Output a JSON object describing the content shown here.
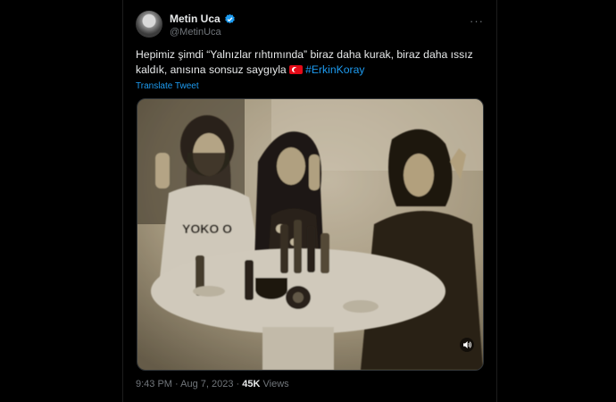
{
  "tweet": {
    "author_name": "Metin Uca",
    "author_handle": "@MetinUca",
    "more_label": "···",
    "text_part1": "Hepimiz  şimdi “Yalnızlar rıhtımında” biraz daha kurak, biraz daha ıssız kaldık, anısına sonsuz saygıyla ",
    "hashtag": "#ErkinKoray",
    "translate_label": "Translate Tweet",
    "time": "9:43 PM",
    "date": "Aug 7, 2023",
    "separator": " · ",
    "views_count": "45K",
    "views_label": "Views"
  },
  "media": {
    "photo_tee_text": "YOKO O",
    "volume_icon": "speaker-icon"
  },
  "colors": {
    "background": "#000000",
    "text": "#e7e9ea",
    "secondary": "#71767b",
    "link": "#1d9bf0",
    "verified": "#1d9bf0"
  }
}
